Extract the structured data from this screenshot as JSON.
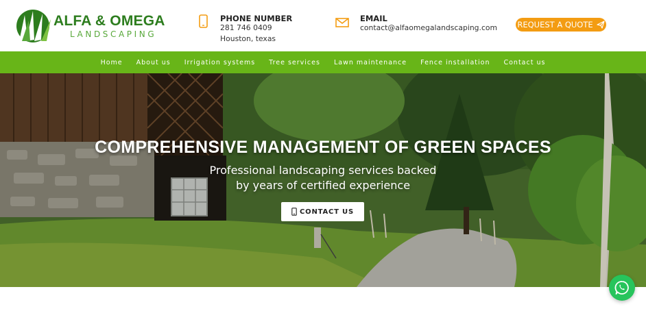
{
  "brand": {
    "title": "ALFA & OMEGA",
    "subtitle": "LANDSCAPING",
    "primary_color": "#68b518",
    "accent_color": "#f39c12"
  },
  "header": {
    "phone": {
      "icon": "phone-icon",
      "title": "PHONE NUMBER",
      "number": "281 746 0409",
      "location": "Houston, texas"
    },
    "email": {
      "icon": "envelope-icon",
      "title": "EMAIL",
      "address": "contact@alfaomegalandscaping.com"
    },
    "quote_button": {
      "label": "REQUEST A QUOTE",
      "icon": "paper-plane-icon"
    }
  },
  "nav": {
    "items": [
      {
        "label": "Home"
      },
      {
        "label": "About us"
      },
      {
        "label": "Irrigation systems"
      },
      {
        "label": "Tree services"
      },
      {
        "label": "Lawn maintenance"
      },
      {
        "label": "Fence installation"
      },
      {
        "label": "Contact us"
      }
    ]
  },
  "hero": {
    "title": "COMPREHENSIVE MANAGEMENT OF GREEN SPACES",
    "subtitle_line1": "Professional landscaping services backed",
    "subtitle_line2": "by years of certified experience",
    "button": {
      "label": "CONTACT US",
      "icon": "mobile-icon"
    }
  },
  "whatsapp": {
    "icon": "whatsapp-icon",
    "color": "#27c45c"
  }
}
